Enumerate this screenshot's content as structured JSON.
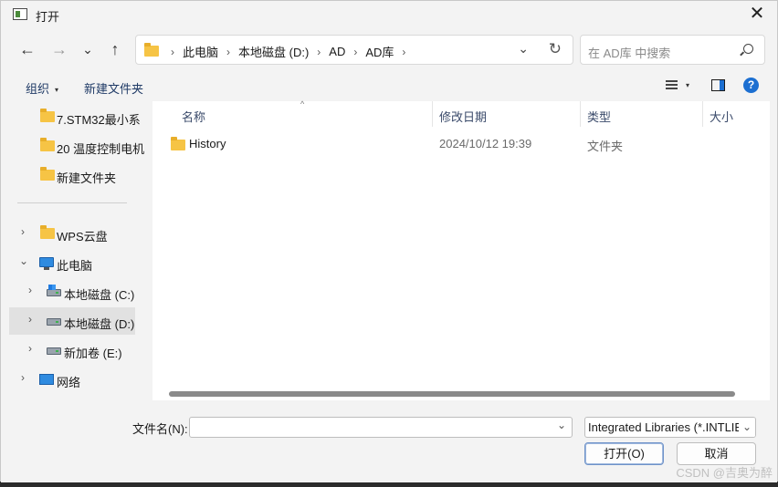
{
  "window": {
    "title": "打开",
    "close": "✕"
  },
  "nav": {
    "back": "←",
    "forward": "→",
    "recent": "⌄",
    "up": "↑"
  },
  "address": {
    "crumbs": [
      "此电脑",
      "本地磁盘 (D:)",
      "AD",
      "AD库"
    ],
    "sep": "›",
    "dropdown": "⌄",
    "refresh": "↻"
  },
  "search": {
    "placeholder": "在 AD库 中搜索"
  },
  "toolbar": {
    "organize": "组织",
    "new_folder": "新建文件夹",
    "caret": "▾",
    "help": "?"
  },
  "sidebar": {
    "items": [
      {
        "label": "7.STM32最小系",
        "icon": "folder-icon"
      },
      {
        "label": "20 温度控制电机",
        "icon": "folder-icon"
      },
      {
        "label": "新建文件夹",
        "icon": "folder-icon"
      },
      {
        "label": "WPS云盘",
        "icon": "folder-icon",
        "chev": "›"
      },
      {
        "label": "此电脑",
        "icon": "pc-icon",
        "chev": "⌄"
      },
      {
        "label": "本地磁盘 (C:)",
        "icon": "drive-icon",
        "chev": "›"
      },
      {
        "label": "本地磁盘 (D:)",
        "icon": "drive-icon",
        "chev": "›",
        "selected": true
      },
      {
        "label": "新加卷 (E:)",
        "icon": "drive-icon",
        "chev": "›"
      },
      {
        "label": "网络",
        "icon": "network-icon",
        "chev": "›"
      }
    ]
  },
  "columns": {
    "name": "名称",
    "modified": "修改日期",
    "type": "类型",
    "size": "大小",
    "sort": "^"
  },
  "files": [
    {
      "name": "History",
      "modified": "2024/10/12 19:39",
      "type": "文件夹",
      "size": ""
    }
  ],
  "footer": {
    "filename_label": "文件名(N):",
    "filename_value": "",
    "filter": "Integrated Libraries (*.INTLIB)",
    "dd": "⌄",
    "open": "打开(O)",
    "cancel": "取消"
  },
  "watermark": "CSDN @吉奥为醉"
}
